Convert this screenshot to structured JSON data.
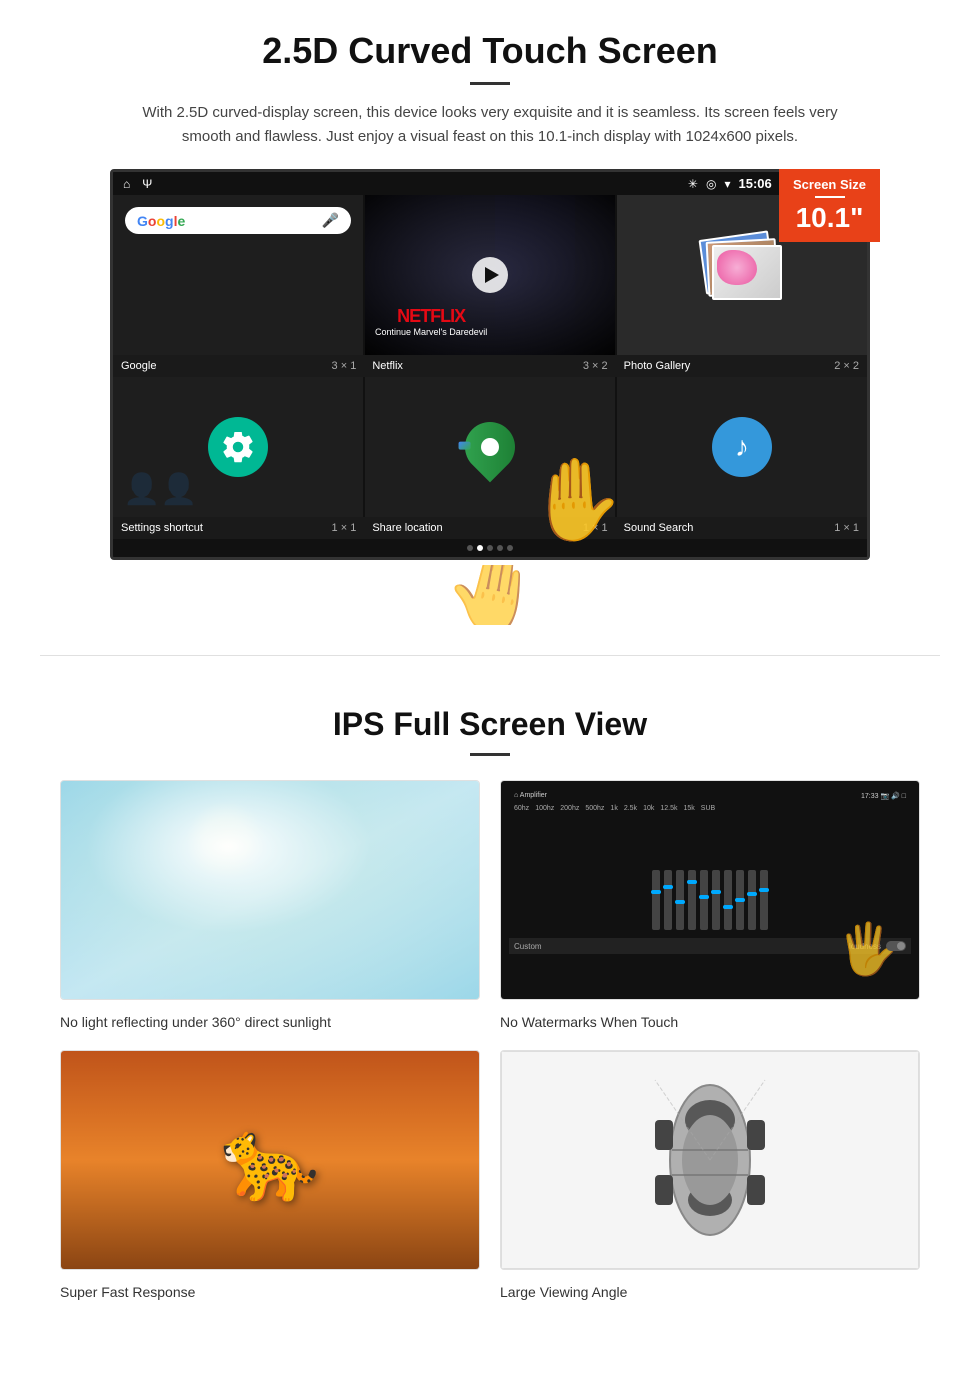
{
  "section1": {
    "title": "2.5D Curved Touch Screen",
    "description": "With 2.5D curved-display screen, this device looks very exquisite and it is seamless. Its screen feels very smooth and flawless. Just enjoy a visual feast on this 10.1-inch display with 1024x600 pixels.",
    "badge": {
      "top": "Screen Size",
      "size": "10.1\""
    },
    "statusBar": {
      "time": "15:06"
    },
    "apps": {
      "row1": [
        {
          "name": "Google",
          "size": "3 × 1"
        },
        {
          "name": "Netflix",
          "size": "3 × 2"
        },
        {
          "name": "Photo Gallery",
          "size": "2 × 2"
        }
      ],
      "row2": [
        {
          "name": "Settings shortcut",
          "size": "1 × 1"
        },
        {
          "name": "Share location",
          "size": "1 × 1"
        },
        {
          "name": "Sound Search",
          "size": "1 × 1"
        }
      ]
    },
    "netflix": {
      "logo": "NETFLIX",
      "subtitle": "Continue Marvel's Daredevil"
    }
  },
  "section2": {
    "title": "IPS Full Screen View",
    "features": [
      {
        "id": "sunlight",
        "label": "No light reflecting under 360° direct sunlight"
      },
      {
        "id": "watermark",
        "label": "No Watermarks When Touch"
      },
      {
        "id": "speed",
        "label": "Super Fast Response"
      },
      {
        "id": "viewing",
        "label": "Large Viewing Angle"
      }
    ]
  }
}
